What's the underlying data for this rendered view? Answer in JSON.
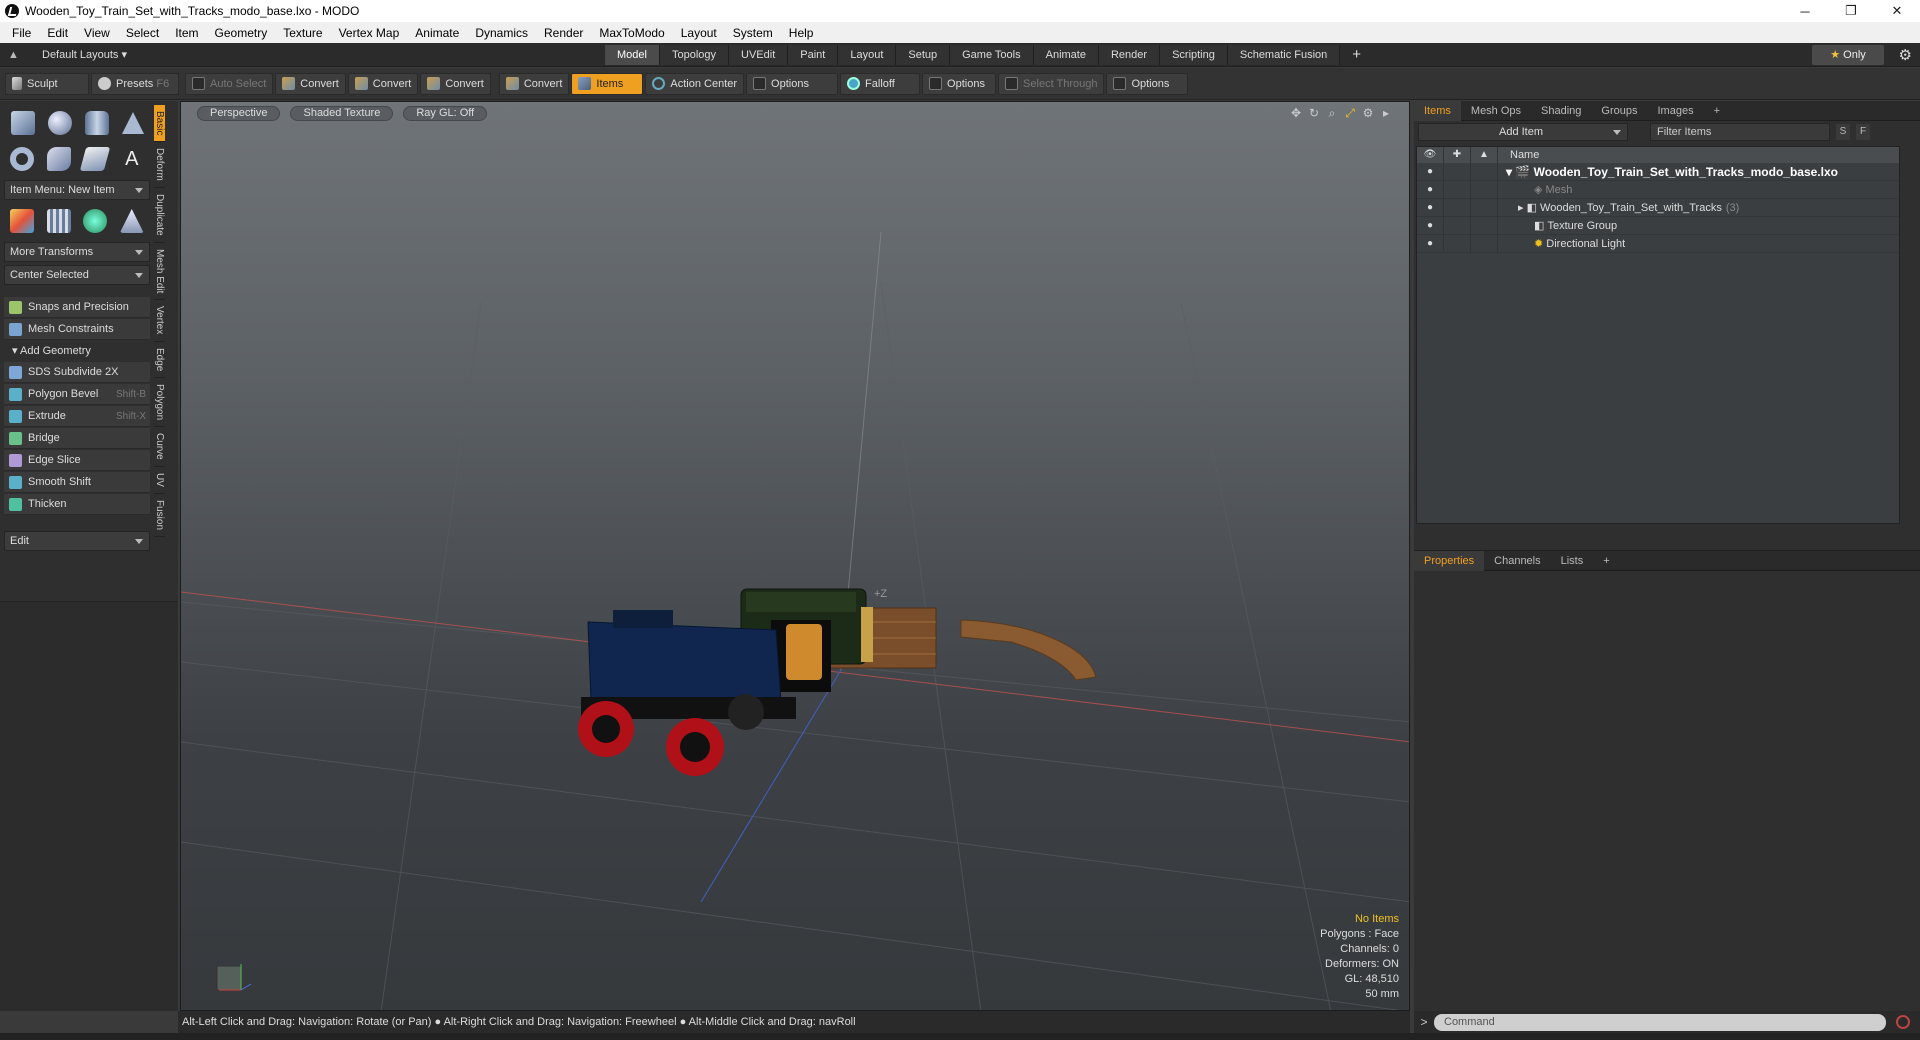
{
  "window": {
    "title": "Wooden_Toy_Train_Set_with_Tracks_modo_base.lxo - MODO",
    "minimize": "─",
    "maximize": "❐",
    "close": "✕"
  },
  "menu": [
    "File",
    "Edit",
    "View",
    "Select",
    "Item",
    "Geometry",
    "Texture",
    "Vertex Map",
    "Animate",
    "Dynamics",
    "Render",
    "MaxToModo",
    "Layout",
    "System",
    "Help"
  ],
  "layouts": {
    "label": "Default Layouts ▾"
  },
  "mode_tabs": [
    "Model",
    "Topology",
    "UVEdit",
    "Paint",
    "Layout",
    "Setup",
    "Game Tools",
    "Animate",
    "Render",
    "Scripting",
    "Schematic Fusion"
  ],
  "mode_plus": "+",
  "only_btn": "Only",
  "toolbar": {
    "sculpt": "Sculpt",
    "presets": "Presets",
    "presets_key": "F6",
    "auto_select": "Auto Select",
    "convert1": "Convert",
    "convert2": "Convert",
    "convert3": "Convert",
    "convert4": "Convert",
    "items": "Items",
    "action_center": "Action Center",
    "options1": "Options",
    "falloff": "Falloff",
    "options2": "Options",
    "select_through": "Select Through",
    "options3": "Options"
  },
  "left": {
    "item_menu": "Item Menu: New Item",
    "more_transforms": "More Transforms",
    "center_selected": "Center Selected",
    "snaps": "Snaps and Precision",
    "mesh_constraints": "Mesh Constraints",
    "add_geometry": "Add Geometry",
    "tools": [
      {
        "label": "SDS Subdivide 2X",
        "key": ""
      },
      {
        "label": "Polygon Bevel",
        "key": "Shift-B"
      },
      {
        "label": "Extrude",
        "key": "Shift-X"
      },
      {
        "label": "Bridge",
        "key": ""
      },
      {
        "label": "Edge Slice",
        "key": ""
      },
      {
        "label": "Smooth Shift",
        "key": ""
      },
      {
        "label": "Thicken",
        "key": ""
      }
    ],
    "edit": "Edit",
    "vtabs": [
      "Basic",
      "Deform",
      "Duplicate",
      "Mesh Edit",
      "Vertex",
      "Edge",
      "Polygon",
      "Curve",
      "UV",
      "Fusion"
    ]
  },
  "viewport": {
    "perspective": "Perspective",
    "shading": "Shaded Texture",
    "raygl": "Ray GL: Off",
    "stats": {
      "no_items": "No Items",
      "polygons": "Polygons : Face",
      "channels": "Channels: 0",
      "deformers": "Deformers: ON",
      "gl": "GL: 48,510",
      "mm": "50 mm"
    }
  },
  "items_panel": {
    "tabs": [
      "Items",
      "Mesh Ops",
      "Shading",
      "Groups",
      "Images"
    ],
    "add_item": "Add Item",
    "filter": "Filter Items",
    "s": "S",
    "f": "F",
    "col_name": "Name",
    "rows": [
      {
        "name": "Wooden_Toy_Train_Set_with_Tracks_modo_base.lxo",
        "count": ""
      },
      {
        "name": "Mesh",
        "count": ""
      },
      {
        "name": "Wooden_Toy_Train_Set_with_Tracks",
        "count": "(3)"
      },
      {
        "name": "Texture Group",
        "count": ""
      },
      {
        "name": "Directional Light",
        "count": ""
      }
    ]
  },
  "props_panel": {
    "tabs": [
      "Properties",
      "Channels",
      "Lists"
    ]
  },
  "status": "Alt-Left Click and Drag: Navigation: Rotate (or Pan) ● Alt-Right Click and Drag: Navigation: Freewheel ● Alt-Middle Click and Drag: navRoll",
  "command": {
    "placeholder": "Command"
  },
  "colors": {
    "accent": "#f0a020",
    "axis_x": "#d04040",
    "axis_z": "#4060d0"
  }
}
